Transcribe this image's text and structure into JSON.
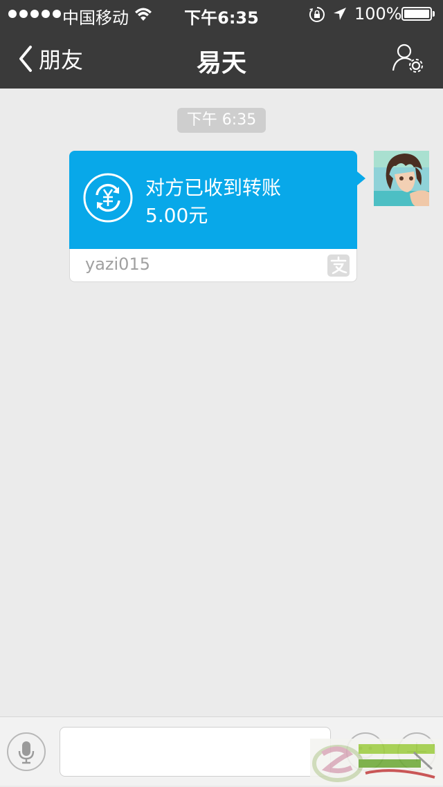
{
  "status_bar": {
    "carrier": "中国移动",
    "time": "下午6:35",
    "battery": "100%"
  },
  "nav": {
    "back_label": "朋友",
    "title": "易天"
  },
  "chat": {
    "timestamp": "下午 6:35",
    "message": {
      "title": "对方已收到转账",
      "amount": "5.00元",
      "sender": "yazi015"
    }
  },
  "input": {
    "value": "",
    "placeholder": ""
  },
  "colors": {
    "nav_bg": "#3a3a3a",
    "chat_bg": "#ebebeb",
    "bubble_blue": "#08a8e9"
  },
  "icons": {
    "back": "chevron-left-icon",
    "profile": "user-settings-icon",
    "transfer": "yuan-transfer-icon",
    "alipay": "alipay-icon",
    "voice": "microphone-icon",
    "emoji": "smiley-icon",
    "more": "plus-icon"
  }
}
